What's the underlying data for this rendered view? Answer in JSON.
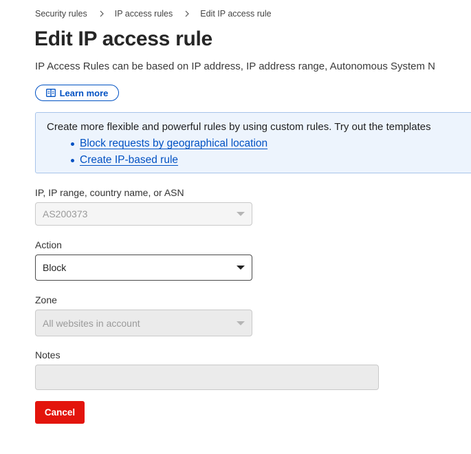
{
  "breadcrumb": {
    "items": [
      "Security rules",
      "IP access rules",
      "Edit IP access rule"
    ]
  },
  "page": {
    "title": "Edit IP access rule",
    "description": "IP Access Rules can be based on IP address, IP address range, Autonomous System N",
    "learn_more": "Learn more"
  },
  "callout": {
    "text": "Create more flexible and powerful rules by using custom rules. Try out the templates",
    "links": [
      "Block requests by geographical location",
      "Create IP-based rule"
    ]
  },
  "form": {
    "target": {
      "label": "IP, IP range, country name, or ASN",
      "value": "AS200373"
    },
    "action": {
      "label": "Action",
      "value": "Block"
    },
    "zone": {
      "label": "Zone",
      "value": "All websites in account"
    },
    "notes": {
      "label": "Notes",
      "value": ""
    },
    "cancel_label": "Cancel"
  },
  "colors": {
    "link": "#0051c3",
    "callout_bg": "#edf4fd",
    "danger": "#e3140c"
  },
  "icons": {
    "breadcrumb_separator": "chevron-right-icon",
    "learn_more": "book-icon",
    "dropdown": "caret-down-icon"
  }
}
